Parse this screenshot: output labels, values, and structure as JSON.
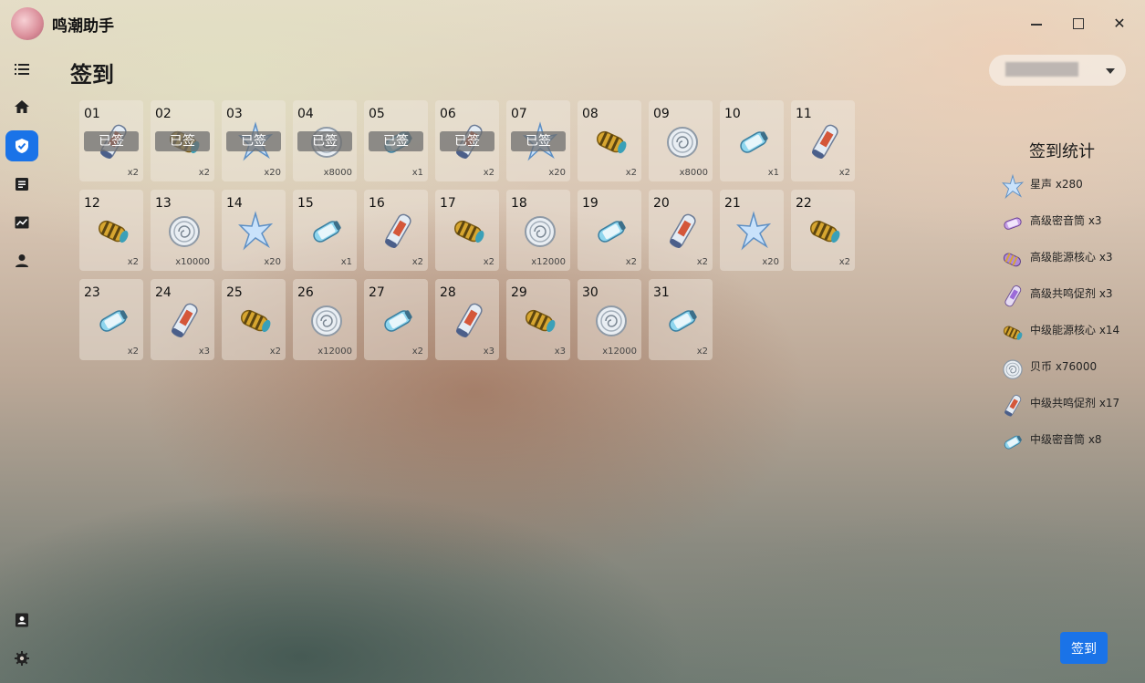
{
  "app": {
    "title": "鸣潮助手"
  },
  "page": {
    "title": "签到"
  },
  "account": {
    "value": ""
  },
  "signed_label": "已签",
  "calendar": [
    {
      "day": "01",
      "item": "mid-tuner",
      "count": "x2",
      "signed": true
    },
    {
      "day": "02",
      "item": "mid-energy-core",
      "count": "x2",
      "signed": true
    },
    {
      "day": "03",
      "item": "astrite",
      "count": "x20",
      "signed": true
    },
    {
      "day": "04",
      "item": "shell-credit",
      "count": "x8000",
      "signed": true
    },
    {
      "day": "05",
      "item": "mid-sealed-tube",
      "count": "x1",
      "signed": true
    },
    {
      "day": "06",
      "item": "mid-tuner",
      "count": "x2",
      "signed": true
    },
    {
      "day": "07",
      "item": "astrite",
      "count": "x20",
      "signed": true
    },
    {
      "day": "08",
      "item": "mid-energy-core",
      "count": "x2",
      "signed": false
    },
    {
      "day": "09",
      "item": "shell-credit",
      "count": "x8000",
      "signed": false
    },
    {
      "day": "10",
      "item": "mid-sealed-tube",
      "count": "x1",
      "signed": false
    },
    {
      "day": "11",
      "item": "mid-tuner",
      "count": "x2",
      "signed": false
    },
    {
      "day": "12",
      "item": "mid-energy-core",
      "count": "x2",
      "signed": false
    },
    {
      "day": "13",
      "item": "shell-credit",
      "count": "x10000",
      "signed": false
    },
    {
      "day": "14",
      "item": "astrite",
      "count": "x20",
      "signed": false
    },
    {
      "day": "15",
      "item": "mid-sealed-tube",
      "count": "x1",
      "signed": false
    },
    {
      "day": "16",
      "item": "mid-tuner",
      "count": "x2",
      "signed": false
    },
    {
      "day": "17",
      "item": "mid-energy-core",
      "count": "x2",
      "signed": false
    },
    {
      "day": "18",
      "item": "shell-credit",
      "count": "x12000",
      "signed": false
    },
    {
      "day": "19",
      "item": "mid-sealed-tube",
      "count": "x2",
      "signed": false
    },
    {
      "day": "20",
      "item": "mid-tuner",
      "count": "x2",
      "signed": false
    },
    {
      "day": "21",
      "item": "astrite",
      "count": "x20",
      "signed": false
    },
    {
      "day": "22",
      "item": "mid-energy-core",
      "count": "x2",
      "signed": false
    },
    {
      "day": "23",
      "item": "mid-sealed-tube",
      "count": "x2",
      "signed": false
    },
    {
      "day": "24",
      "item": "mid-tuner",
      "count": "x3",
      "signed": false
    },
    {
      "day": "25",
      "item": "mid-energy-core",
      "count": "x2",
      "signed": false
    },
    {
      "day": "26",
      "item": "shell-credit",
      "count": "x12000",
      "signed": false
    },
    {
      "day": "27",
      "item": "mid-sealed-tube",
      "count": "x2",
      "signed": false
    },
    {
      "day": "28",
      "item": "mid-tuner",
      "count": "x3",
      "signed": false
    },
    {
      "day": "29",
      "item": "mid-energy-core",
      "count": "x3",
      "signed": false
    },
    {
      "day": "30",
      "item": "shell-credit",
      "count": "x12000",
      "signed": false
    },
    {
      "day": "31",
      "item": "mid-sealed-tube",
      "count": "x2",
      "signed": false
    }
  ],
  "stats": {
    "title": "签到统计",
    "items": [
      {
        "label": "星声 x280",
        "icon": "astrite"
      },
      {
        "label": "高级密音筒 x3",
        "icon": "adv-sealed-tube"
      },
      {
        "label": "高级能源核心 x3",
        "icon": "adv-energy-core"
      },
      {
        "label": "高级共鸣促剂 x3",
        "icon": "adv-tuner"
      },
      {
        "label": "中级能源核心 x14",
        "icon": "mid-energy-core"
      },
      {
        "label": "贝币 x76000",
        "icon": "shell-credit"
      },
      {
        "label": "中级共鸣促剂 x17",
        "icon": "mid-tuner"
      },
      {
        "label": "中级密音筒 x8",
        "icon": "mid-sealed-tube"
      }
    ]
  },
  "actions": {
    "sign_label": "签到"
  },
  "colors": {
    "accent": "#1a73e8"
  }
}
